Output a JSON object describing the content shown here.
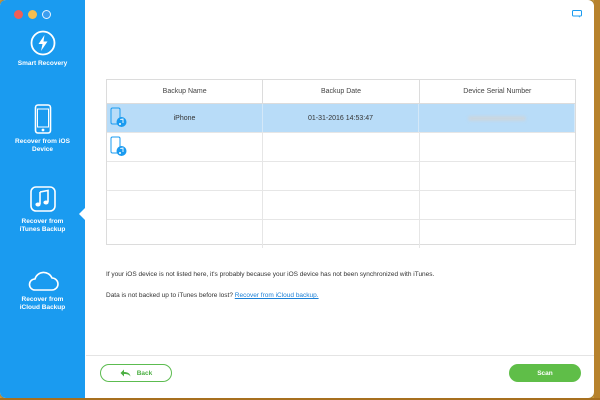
{
  "sidebar": {
    "items": [
      {
        "label": "Smart Recovery",
        "icon": "lightning-icon"
      },
      {
        "label": "Recover from iOS\nDevice",
        "icon": "phone-icon"
      },
      {
        "label": "Recover from\niTunes Backup",
        "icon": "music-note-icon"
      },
      {
        "label": "Recover from\niCloud Backup",
        "icon": "cloud-icon"
      }
    ],
    "active_index": 2,
    "background": "#1a9bf0"
  },
  "table": {
    "columns": [
      "Backup Name",
      "Backup Date",
      "Device Serial Number"
    ],
    "rows": [
      {
        "name": "iPhone",
        "date": "01-31-2016 14:53:47",
        "serial": "",
        "selected": true
      },
      {
        "name": "",
        "date": "",
        "serial": "",
        "selected": false
      }
    ]
  },
  "messages": {
    "not_listed": "If your iOS device is not listed here, it's probably because your iOS device has not been synchronized with iTunes.",
    "not_backed_prefix": "Data is not backed up to iTunes before lost?",
    "icloud_link": "Recover from iCloud backup."
  },
  "buttons": {
    "back": "Back",
    "scan": "Scan"
  },
  "colors": {
    "accent": "#1a9bf0",
    "selected_row": "#b8dcf8",
    "green": "#5fbe48"
  }
}
